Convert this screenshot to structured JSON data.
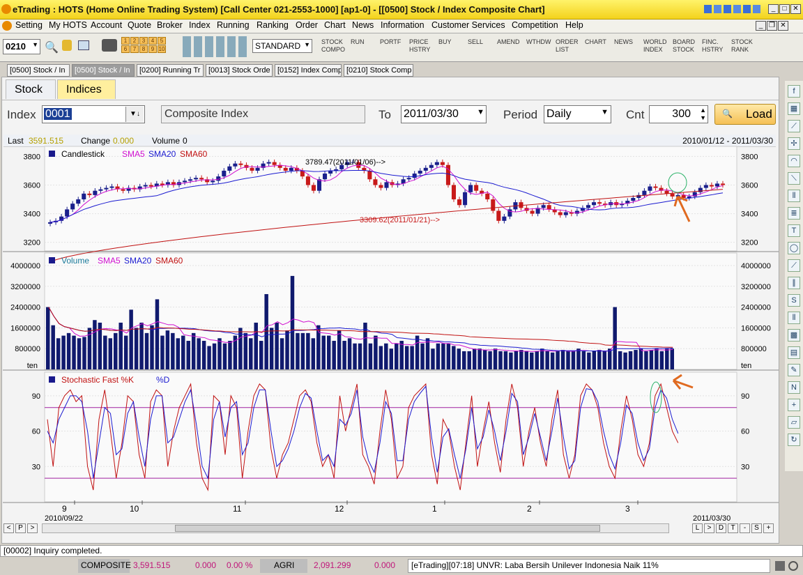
{
  "window": {
    "title": "eTrading : HOTS (Home Online Trading System) [Call Center 021-2553-1000] [ap1-0] - [[0500] Stock / Index Composite Chart]"
  },
  "menu": [
    "Setting",
    "My HOTS",
    "Account",
    "Quote",
    "Broker",
    "Index",
    "Running",
    "Ranking",
    "Order",
    "Chart",
    "News",
    "Information",
    "Customer Services",
    "Competition",
    "Help"
  ],
  "toolbar": {
    "code": "0210",
    "numbers": [
      "1",
      "2",
      "3",
      "4",
      "5",
      "6",
      "7",
      "8",
      "9",
      "10"
    ],
    "layout": "STANDARD",
    "buttons": [
      "STOCK\nCOMPO",
      "RUN",
      "PORTF",
      "PRICE\nHSTRY",
      "BUY",
      "SELL",
      "AMEND",
      "WTHDW",
      "ORDER\nLIST",
      "CHART",
      "NEWS",
      "WORLD\nINDEX",
      "BOARD\nSTOCK",
      "FINC.\nHSTRY",
      "STOCK\nRANK"
    ]
  },
  "window_tabs": [
    "[0500] Stock / In",
    "[0500] Stock / In",
    "[0200] Running Tr",
    "[0013] Stock Orde",
    "[0152] Index Comp",
    "[0210] Stock Comp"
  ],
  "inner_tabs": {
    "stock": "Stock",
    "indices": "Indices"
  },
  "form": {
    "index_label": "Index",
    "index_code": "0001",
    "index_name": "Composite Index",
    "to_label": "To",
    "to_date": "2011/03/30",
    "period_label": "Period",
    "period": "Daily",
    "cnt_label": "Cnt",
    "cnt": "300",
    "load": "Load"
  },
  "info": {
    "last_label": "Last",
    "last": "3591.515",
    "change_label": "Change",
    "change": "0.000",
    "volume_label": "Volume",
    "volume": "0",
    "range": "2010/01/12 - 2011/03/30"
  },
  "chart_data": [
    {
      "type": "candlestick",
      "title": "Candlestick",
      "legend": [
        "SMA5",
        "SMA20",
        "SMA60"
      ],
      "yticks": [
        3200,
        3400,
        3600,
        3800
      ],
      "ylim": [
        3140,
        3870
      ],
      "annotations": [
        "3789.47(2011/01/06)-->",
        "3309.62(2011/01/21)-->"
      ],
      "close": [
        3340,
        3350,
        3380,
        3430,
        3470,
        3500,
        3540,
        3530,
        3560,
        3570,
        3580,
        3590,
        3570,
        3560,
        3580,
        3570,
        3590,
        3600,
        3590,
        3610,
        3600,
        3620,
        3600,
        3620,
        3630,
        3640,
        3650,
        3640,
        3620,
        3630,
        3660,
        3700,
        3730,
        3750,
        3740,
        3720,
        3700,
        3720,
        3750,
        3760,
        3740,
        3720,
        3700,
        3720,
        3700,
        3660,
        3600,
        3560,
        3640,
        3680,
        3700,
        3710,
        3740,
        3760,
        3760,
        3720,
        3700,
        3640,
        3600,
        3580,
        3620,
        3600,
        3610,
        3640,
        3650,
        3680,
        3700,
        3720,
        3740,
        3760,
        3740,
        3600,
        3500,
        3460,
        3550,
        3600,
        3560,
        3540,
        3500,
        3420,
        3350,
        3380,
        3430,
        3480,
        3440,
        3420,
        3400,
        3440,
        3460,
        3430,
        3410,
        3390,
        3410,
        3400,
        3420,
        3440,
        3460,
        3480,
        3470,
        3460,
        3480,
        3460,
        3470,
        3490,
        3510,
        3530,
        3560,
        3590,
        3580,
        3560,
        3540,
        3520,
        3530,
        3510,
        3520,
        3550,
        3580,
        3600,
        3590,
        3610,
        3600
      ],
      "sma60_start": 3060,
      "sma60_end": 3570
    },
    {
      "type": "bar",
      "title": "Volume",
      "legend": [
        "SMA5",
        "SMA20",
        "SMA60"
      ],
      "yticks": [
        800000,
        1600000,
        2400000,
        3200000,
        4000000
      ],
      "unit": "ten",
      "ylim": [
        0,
        4000000
      ],
      "values": [
        2400000,
        1700000,
        1200000,
        1300000,
        1400000,
        1300000,
        1200000,
        1250000,
        1600000,
        1900000,
        1800000,
        1300000,
        1200000,
        1400000,
        1800000,
        1300000,
        2300000,
        1600000,
        1800000,
        1400000,
        1700000,
        2700000,
        1300000,
        1500000,
        1400000,
        1200000,
        1300000,
        1100000,
        1400000,
        1200000,
        1100000,
        900000,
        1000000,
        1200000,
        1000000,
        1100000,
        1300000,
        1600000,
        1400000,
        1200000,
        1800000,
        1100000,
        2900000,
        1600000,
        1800000,
        1200000,
        1500000,
        3600000,
        1400000,
        1400000,
        1400000,
        1200000,
        1700000,
        1300000,
        1300000,
        1100000,
        1500000,
        1100000,
        1200000,
        1000000,
        1000000,
        1800000,
        1000000,
        1300000,
        900000,
        1000000,
        800000,
        1000000,
        1100000,
        900000,
        900000,
        1300000,
        1000000,
        1200000,
        800000,
        1000000,
        1000000,
        1000000,
        900000,
        800000,
        700000,
        700000,
        800000,
        800000,
        750000,
        700000,
        800000,
        700000,
        700000,
        650000,
        700000,
        750000,
        700000,
        650000,
        700000,
        800000,
        700000,
        650000,
        700000,
        750000,
        700000,
        700000,
        800000,
        700000,
        650000,
        700000,
        750000,
        700000,
        800000,
        2400000,
        700000,
        650000,
        700000,
        750000,
        800000,
        700000,
        750000,
        800000,
        700000,
        800000,
        800000
      ]
    },
    {
      "type": "line",
      "title": "Stochastic Fast %K",
      "legend": [
        "%D"
      ],
      "yticks": [
        30,
        60,
        90
      ],
      "ylim": [
        0,
        110
      ],
      "bands": [
        20,
        80
      ],
      "x_labels": [
        "9",
        "10",
        "11",
        "12",
        "1",
        "2",
        "3"
      ],
      "start_date": "2010/09/22",
      "end_date": "2011/03/30",
      "k": [
        70,
        30,
        80,
        90,
        95,
        85,
        90,
        30,
        10,
        70,
        95,
        60,
        20,
        50,
        90,
        85,
        40,
        20,
        85,
        95,
        90,
        30,
        60,
        80,
        90,
        100,
        50,
        20,
        10,
        90,
        85,
        40,
        90,
        80,
        20,
        60,
        90,
        100,
        95,
        45,
        20,
        40,
        50,
        70,
        90,
        95,
        85,
        50,
        30,
        40,
        20,
        90,
        60,
        80,
        100,
        40,
        30,
        15,
        60,
        95,
        70,
        20,
        30,
        80,
        90,
        95,
        100,
        40,
        15,
        70,
        60,
        30,
        10,
        50,
        90,
        30,
        60,
        85,
        50,
        25,
        70,
        100,
        80,
        30,
        60,
        80,
        50,
        30,
        70,
        95,
        40,
        20,
        40,
        90,
        100,
        95,
        80,
        50,
        30,
        20,
        60,
        90,
        70,
        40,
        30,
        50,
        90,
        100,
        80,
        60,
        50
      ],
      "d": [
        60,
        50,
        70,
        80,
        90,
        90,
        85,
        60,
        20,
        50,
        80,
        75,
        40,
        45,
        75,
        85,
        55,
        30,
        70,
        90,
        90,
        50,
        55,
        70,
        85,
        95,
        65,
        30,
        20,
        70,
        85,
        55,
        80,
        85,
        40,
        50,
        80,
        95,
        95,
        60,
        30,
        35,
        45,
        60,
        80,
        92,
        88,
        60,
        35,
        40,
        30,
        70,
        65,
        75,
        95,
        55,
        35,
        25,
        50,
        85,
        75,
        35,
        35,
        70,
        85,
        92,
        98,
        55,
        25,
        55,
        62,
        40,
        20,
        45,
        80,
        45,
        55,
        78,
        60,
        35,
        60,
        92,
        85,
        40,
        55,
        75,
        55,
        35,
        60,
        88,
        55,
        28,
        35,
        80,
        96,
        95,
        85,
        60,
        40,
        28,
        50,
        82,
        75,
        50,
        35,
        45,
        80,
        95,
        88,
        70,
        58
      ]
    }
  ],
  "sidebar_icons": [
    "fib-icon",
    "grid-icon",
    "draw-icon",
    "cross-icon",
    "arc-icon",
    "trend-icon",
    "bars-icon",
    "list-icon",
    "text-icon",
    "oval-icon",
    "slope-icon",
    "channel-icon",
    "s-icon",
    "columns-icon",
    "mesh-icon",
    "table-icon",
    "edit-icon",
    "n-icon",
    "plus-icon",
    "eraser-icon",
    "refresh-icon"
  ],
  "status": "[00002] Inquiry completed.",
  "ticker": {
    "composite_label": "COMPOSITE",
    "composite": "3,591.515",
    "comp_change": "0.000",
    "comp_pct": "0.00 %",
    "agri_label": "AGRI",
    "agri": "2,091.299",
    "agri_change": "0.000",
    "news": "[eTrading][07:18] UNVR: Laba Bersih Unilever Indonesia Naik 11%"
  },
  "nav_buttons": [
    "<",
    "P",
    ">",
    "L",
    ">",
    "D",
    "T",
    "-",
    "S",
    "+"
  ],
  "colors": {
    "up": "#1a1f8c",
    "down": "#c81a1a",
    "sma5": "#d00fd0",
    "sma20": "#1a1ad0",
    "sma60": "#c01010",
    "volbar": "#101a6e",
    "stochk": "#c01010",
    "stochd": "#1a1ad0",
    "band": "#a020a0",
    "annot": "#e06a20"
  }
}
